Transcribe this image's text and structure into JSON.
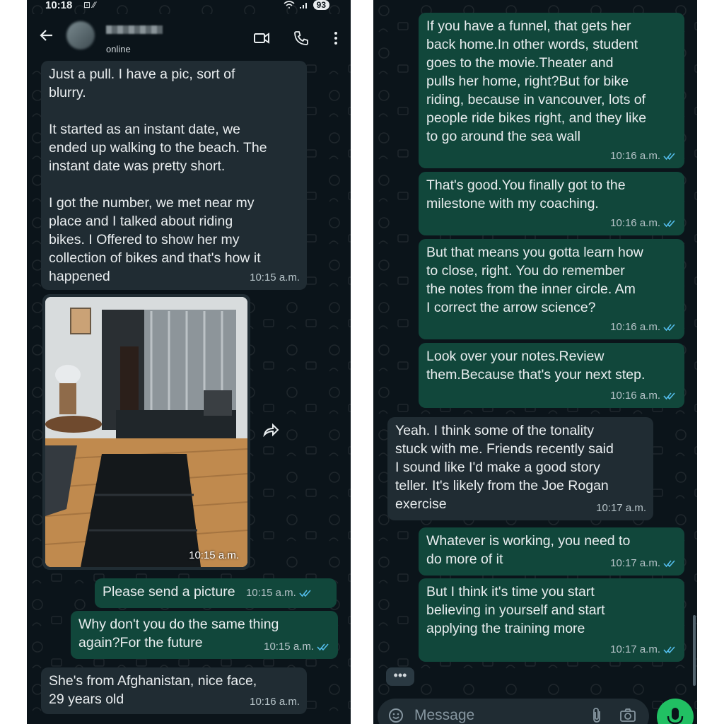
{
  "status_bar": {
    "time": "10:18",
    "glyphs": "⊡ ⁄⁄",
    "battery": "93"
  },
  "header": {
    "presence": "online"
  },
  "left_messages": [
    {
      "dir": "in",
      "text": "Just a pull. I have a pic, sort of\nblurry.\n\nIt started as an instant date, we\nended up walking to the beach. The\ninstant date was pretty short.\n\nI got the number, we met near my\nplace and I talked about riding\nbikes. I Offered to show her my\ncollection of bikes and that's how it\nhappened",
      "time": "10:15 a.m."
    },
    {
      "dir": "out",
      "text": "Please send a picture",
      "time": "10:15 a.m."
    },
    {
      "dir": "out",
      "text": "Why don't you do the same thing\nagain?For the future",
      "time": "10:15 a.m."
    },
    {
      "dir": "in",
      "text": "She's from Afghanistan, nice face,\n29 years old",
      "time": "10:16 a.m."
    }
  ],
  "photo": {
    "time": "10:15 a.m."
  },
  "right_messages": [
    {
      "dir": "out",
      "text": "If you have a funnel, that gets her\nback home.In other words, student\ngoes to the movie.Theater and\npulls her home, right?But for bike\nriding, because in vancouver, lots of\npeople ride bikes right, and they like\nto go around the sea wall",
      "time": "10:16 a.m."
    },
    {
      "dir": "out",
      "text": "That's good.You finally got to the\nmilestone with my coaching.",
      "time": "10:16 a.m."
    },
    {
      "dir": "out",
      "text": "But that means you gotta learn how\nto close, right. You do remember\nthe notes from the inner circle. Am\nI correct the arrow science?",
      "time": "10:16 a.m."
    },
    {
      "dir": "out",
      "text": "Look over your notes.Review\nthem.Because that's your next step.",
      "time": "10:16 a.m."
    },
    {
      "dir": "in",
      "text": "Yeah. I think some of the tonality\nstuck with me. Friends recently said\nI sound like I'd make a good story\nteller. It's likely from the Joe Rogan\nexercise",
      "time": "10:17 a.m."
    },
    {
      "dir": "out",
      "text": "Whatever is working, you need to\ndo more of it",
      "time": "10:17 a.m."
    },
    {
      "dir": "out",
      "text": "But I think it's time you start\nbelieving in yourself and start\napplying the training more",
      "time": "10:17 a.m."
    }
  ],
  "composer": {
    "placeholder": "Message",
    "more_label": "•••"
  },
  "icons": [
    "back-arrow-icon",
    "video-call-icon",
    "phone-icon",
    "more-vertical-icon",
    "forward-icon",
    "emoji-icon",
    "attach-icon",
    "camera-icon",
    "mic-icon",
    "double-check-icon"
  ],
  "colors": {
    "background": "#0b141a",
    "incoming": "#202c33",
    "outgoing": "#11473b",
    "read_ticks": "#53bdeb",
    "mic": "#21c063"
  }
}
